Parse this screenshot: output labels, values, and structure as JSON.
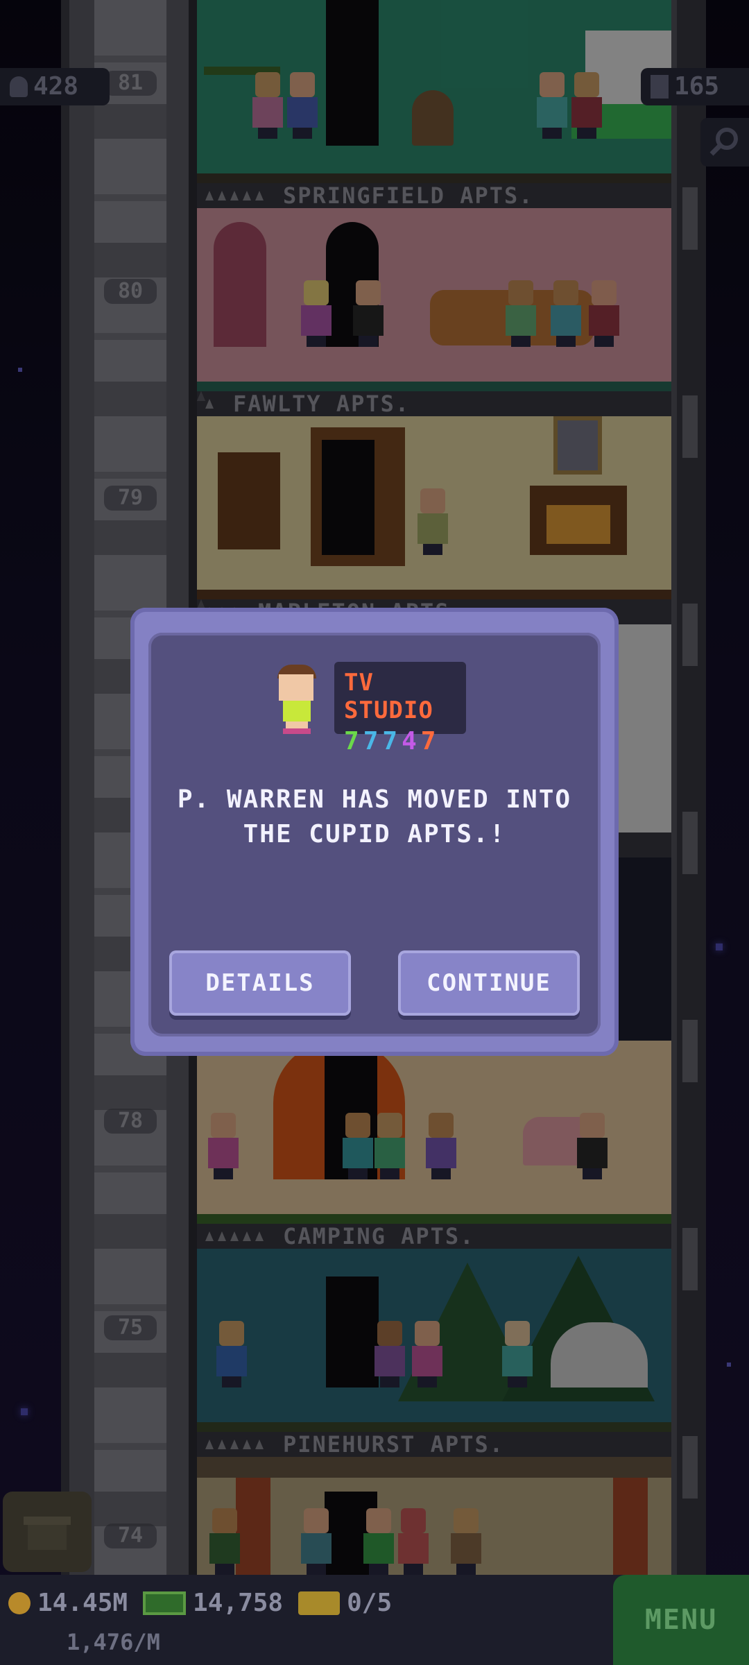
{
  "hud": {
    "population": "428",
    "floors": "165",
    "coins": "14.45M",
    "bux": "14,758",
    "tickets": "0/5",
    "rate": "1,476/M",
    "menu_label": "MENU"
  },
  "floors": [
    {
      "number": "81",
      "name": "SPRINGFIELD APTS.",
      "rating": 5,
      "filled": 5,
      "wall": "#2e8f72"
    },
    {
      "number": "80",
      "name": "FAWLTY APTS.",
      "rating": 5,
      "filled": 1,
      "wall": "#d89aa4"
    },
    {
      "number": "79",
      "name": "MAPLETON APTS.",
      "rating": 5,
      "filled": 3,
      "wall": "#e7d9a4"
    },
    {
      "number": "78",
      "name": "CAMPING APTS.",
      "rating": 5,
      "filled": 5,
      "wall": "#e7caa0"
    },
    {
      "number": "75",
      "name": "PINEHURST APTS.",
      "rating": 5,
      "filled": 5,
      "wall": "#2c6a7a"
    },
    {
      "number": "74",
      "name": "",
      "rating": 0,
      "filled": 0,
      "wall": "#b8a882"
    }
  ],
  "dialog": {
    "job_title": "TV STUDIO",
    "dream_digits": [
      "7",
      "7",
      "7",
      "4",
      "7"
    ],
    "digit_colors": [
      "#6bd94a",
      "#4ab7e7",
      "#4ab7e7",
      "#c45ae7",
      "#ff6a3c"
    ],
    "message_line1": "P. WARREN HAS MOVED INTO",
    "message_line2": "THE CUPID APTS.!",
    "details_label": "DETAILS",
    "continue_label": "CONTINUE"
  },
  "colors": {
    "dialog_outer": "#8481c4",
    "dialog_inner": "#54507e",
    "menu_green": "#1f5a2c"
  }
}
